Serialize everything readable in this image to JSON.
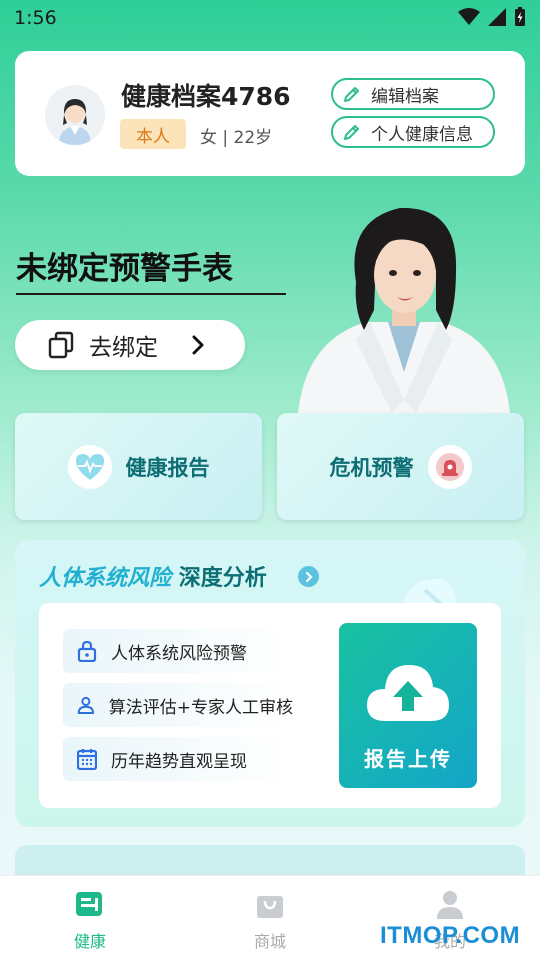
{
  "status_bar": {
    "time": "1:56"
  },
  "profile": {
    "title": "健康档案4786",
    "badge": "本人",
    "meta": "女 | 22岁",
    "edit_button": "编辑档案",
    "health_info_button": "个人健康信息"
  },
  "watch": {
    "title": "未绑定预警手表",
    "bind_button": "去绑定"
  },
  "quick_actions": {
    "health_report": "健康报告",
    "crisis_alert": "危机预警"
  },
  "analysis": {
    "title_a": "人体系统风险",
    "title_b": "深度分析",
    "features": [
      "人体系统风险预警",
      "算法评估+专家人工审核",
      "历年趋势直观呈现"
    ],
    "upload_label": "报告上传"
  },
  "tabbar": {
    "tabs": [
      {
        "label": "健康"
      },
      {
        "label": "商城"
      },
      {
        "label": "我的"
      }
    ]
  },
  "watermark": "ITMOP.COM",
  "colors": {
    "accent": "#1fb88a",
    "title_teal": "#0d6e74",
    "title_blue": "#22b0d0",
    "badge_bg": "#fde3b9"
  }
}
